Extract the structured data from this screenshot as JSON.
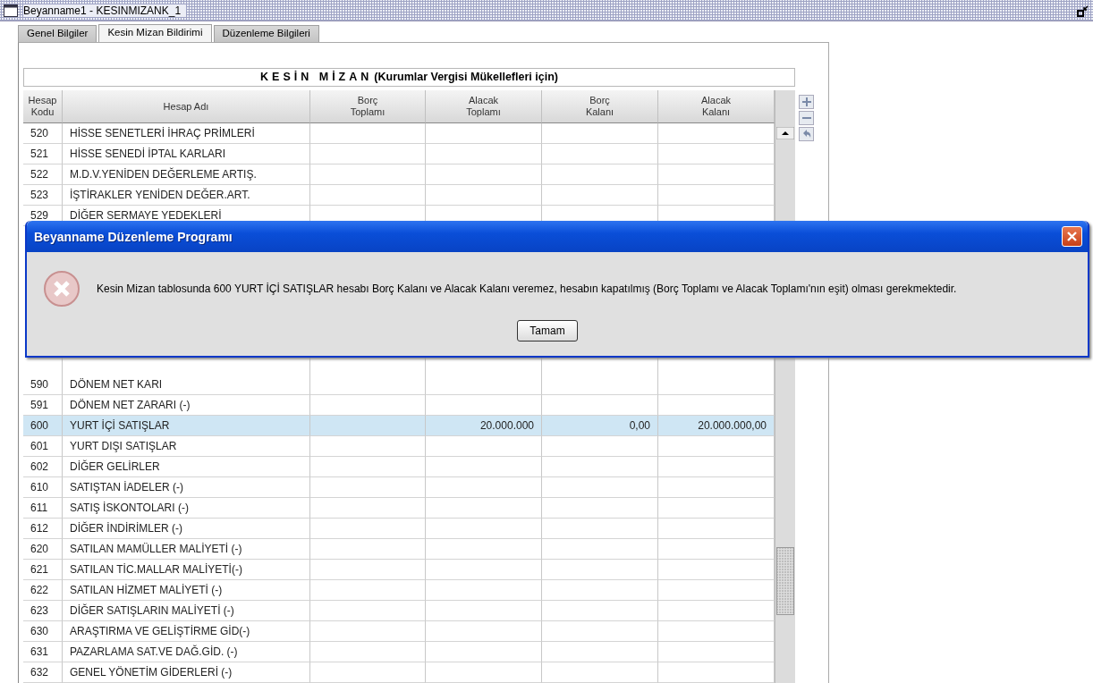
{
  "window": {
    "title": "Beyanname1 - KESINMIZANK_1"
  },
  "tabs": [
    {
      "label": "Genel Bilgiler",
      "selected": false
    },
    {
      "label": "Kesin Mizan Bildirimi",
      "selected": true
    },
    {
      "label": "Düzenleme Bilgileri",
      "selected": false
    }
  ],
  "table": {
    "title_main": "KESİN MİZAN",
    "title_sub": "(Kurumlar Vergisi Mükellefleri için)",
    "columns": [
      [
        "Hesap",
        "Kodu"
      ],
      [
        "Hesap Adı"
      ],
      [
        "Borç",
        "Toplamı"
      ],
      [
        "Alacak",
        "Toplamı"
      ],
      [
        "Borç",
        "Kalanı"
      ],
      [
        "Alacak",
        "Kalanı"
      ]
    ],
    "rows_above": [
      {
        "code": "520",
        "name": "HİSSE SENETLERİ İHRAÇ PRİMLERİ",
        "selected": false
      },
      {
        "code": "521",
        "name": "HİSSE SENEDİ İPTAL KARLARI",
        "selected": false
      },
      {
        "code": "522",
        "name": "M.D.V.YENİDEN DEĞERLEME ARTIŞ.",
        "selected": false
      },
      {
        "code": "523",
        "name": "İŞTİRAKLER YENİDEN DEĞER.ART.",
        "selected": false
      },
      {
        "code": "529",
        "name": "DİĞER SERMAYE YEDEKLERİ",
        "selected": false
      }
    ],
    "rows_below": [
      {
        "code": "590",
        "name": "DÖNEM NET KARI",
        "selected": false
      },
      {
        "code": "591",
        "name": "DÖNEM NET ZARARI (-)",
        "selected": false
      },
      {
        "code": "600",
        "name": "YURT İÇİ SATIŞLAR",
        "selected": true,
        "alacak_toplami": "20.000.000",
        "borc_kalani": "0,00",
        "alacak_kalani": "20.000.000,00"
      },
      {
        "code": "601",
        "name": "YURT DIŞI SATIŞLAR",
        "selected": false
      },
      {
        "code": "602",
        "name": "DİĞER GELİRLER",
        "selected": false
      },
      {
        "code": "610",
        "name": "SATIŞTAN İADELER (-)",
        "selected": false
      },
      {
        "code": "611",
        "name": "SATIŞ İSKONTOLARI (-)",
        "selected": false
      },
      {
        "code": "612",
        "name": "DİĞER İNDİRİMLER (-)",
        "selected": false
      },
      {
        "code": "620",
        "name": "SATILAN MAMÜLLER MALİYETİ (-)",
        "selected": false
      },
      {
        "code": "621",
        "name": "SATILAN TİC.MALLAR MALİYETİ(-)",
        "selected": false
      },
      {
        "code": "622",
        "name": "SATILAN HİZMET MALİYETİ (-)",
        "selected": false
      },
      {
        "code": "623",
        "name": "DİĞER SATIŞLARIN MALİYETİ (-)",
        "selected": false
      },
      {
        "code": "630",
        "name": "ARAŞTIRMA VE GELİŞTİRME GİD(-)",
        "selected": false
      },
      {
        "code": "631",
        "name": "PAZARLAMA SAT.VE DAĞ.GİD. (-)",
        "selected": false
      },
      {
        "code": "632",
        "name": "GENEL YÖNETİM GİDERLERİ (-)",
        "selected": false
      }
    ]
  },
  "dialog": {
    "title": "Beyanname Düzenleme Programı",
    "message": "Kesin Mizan tablosunda 600 YURT İÇİ SATIŞLAR hesabı Borç Kalanı ve Alacak Kalanı veremez, hesabın kapatılmış (Borç Toplamı ve Alacak Toplamı'nın eşit) olması gerekmektedir.",
    "button": "Tamam"
  }
}
